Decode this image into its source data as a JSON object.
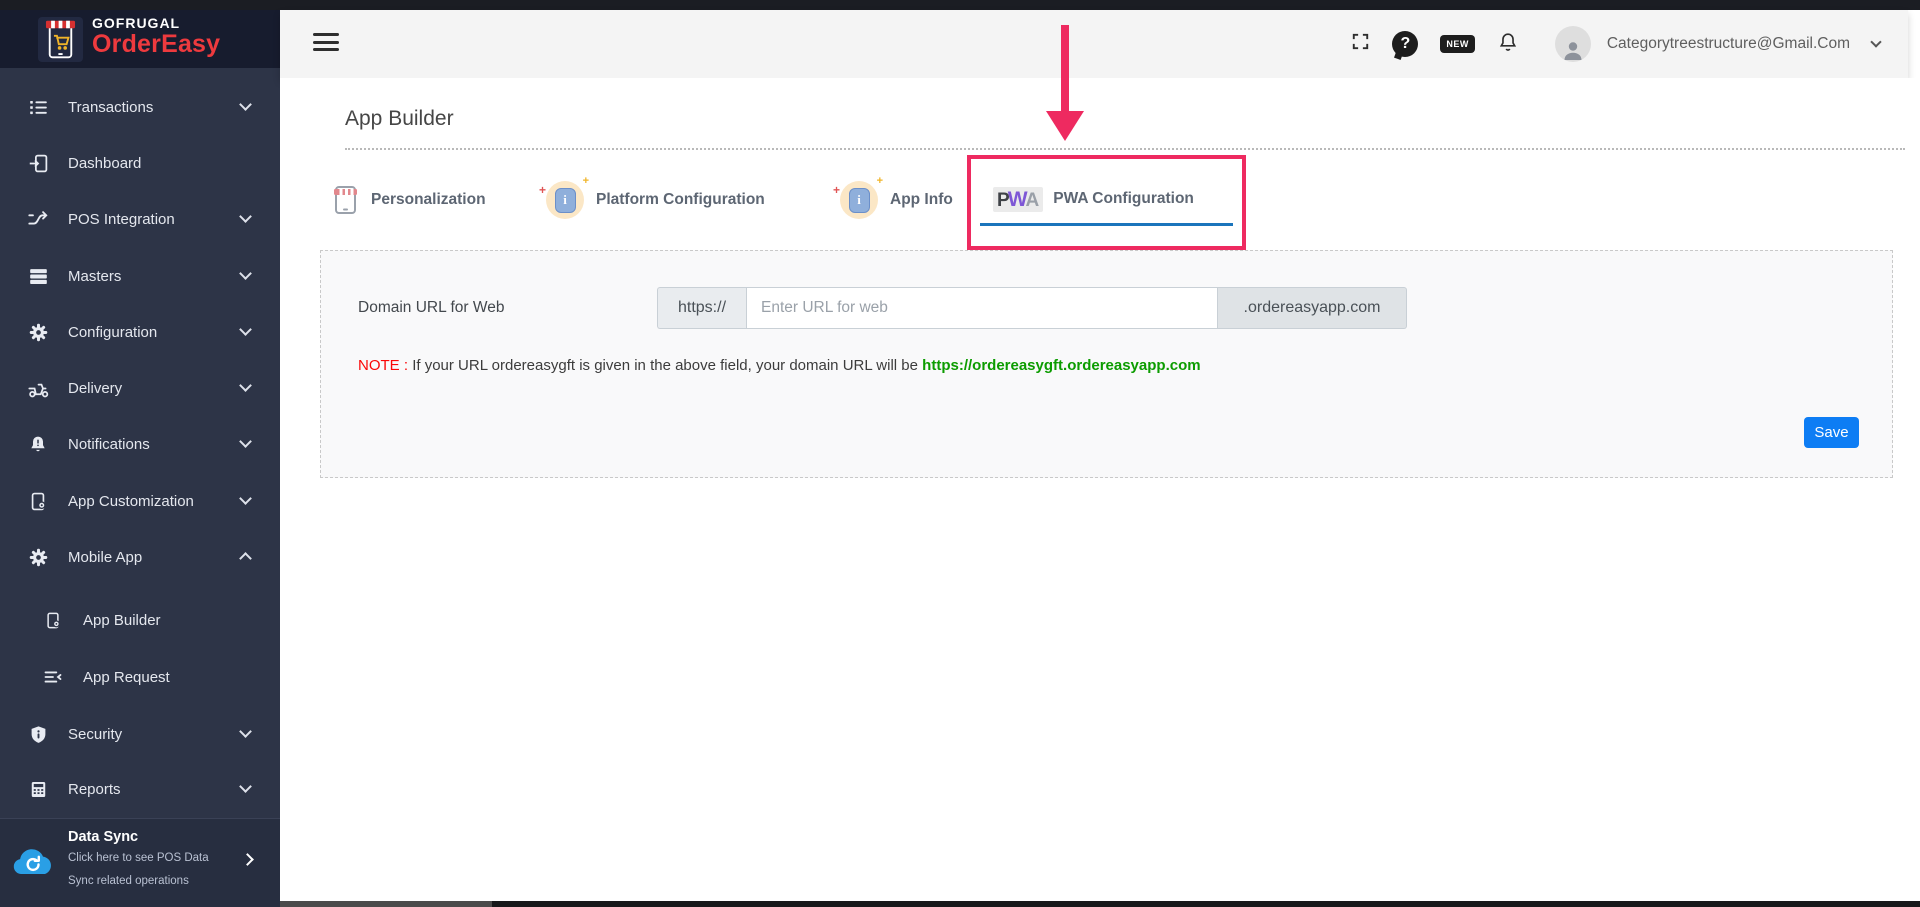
{
  "brand": {
    "company": "GOFRUGAL",
    "product": "OrderEasy"
  },
  "topbar": {
    "user_email": "Categorytreestructure@Gmail.Com",
    "new_badge": "NEW",
    "help_glyph": "?"
  },
  "sidebar": {
    "items": [
      {
        "label": "Transactions",
        "icon": "transactions-list-icon",
        "chevron": "down"
      },
      {
        "label": "Dashboard",
        "icon": "dashboard-icon",
        "chevron": ""
      },
      {
        "label": "POS Integration",
        "icon": "pos-integration-icon",
        "chevron": "down"
      },
      {
        "label": "Masters",
        "icon": "masters-stack-icon",
        "chevron": "down"
      },
      {
        "label": "Configuration",
        "icon": "gear-icon",
        "chevron": "down"
      },
      {
        "label": "Delivery",
        "icon": "delivery-scooter-icon",
        "chevron": "down"
      },
      {
        "label": "Notifications",
        "icon": "bell-icon",
        "chevron": "down"
      },
      {
        "label": "App Customization",
        "icon": "phone-gear-icon",
        "chevron": "down"
      },
      {
        "label": "Mobile App",
        "icon": "gear-icon",
        "chevron": "up"
      },
      {
        "label": "App Builder",
        "icon": "phone-gear-icon",
        "chevron": "",
        "sub": true
      },
      {
        "label": "App Request",
        "icon": "list-chevron-icon",
        "chevron": "",
        "sub": true
      },
      {
        "label": "Security",
        "icon": "shield-icon",
        "chevron": "down"
      },
      {
        "label": "Reports",
        "icon": "reports-icon",
        "chevron": "down"
      }
    ],
    "datasync": {
      "title": "Data Sync",
      "line1": "Click here to see POS Data",
      "line2": "Sync related operations"
    }
  },
  "page": {
    "title": "App Builder"
  },
  "tabs": [
    {
      "label": "Personalization"
    },
    {
      "label": "Platform Configuration"
    },
    {
      "label": "App Info"
    },
    {
      "label": "PWA Configuration",
      "active": true
    }
  ],
  "pwa_logo": {
    "p": "P",
    "w": "W",
    "a": "A"
  },
  "form": {
    "domain_label": "Domain URL for Web",
    "url_prefix": "https://",
    "url_placeholder": "Enter URL for web",
    "url_suffix": ".ordereasyapp.com",
    "note_label": "NOTE :",
    "note_text": "If your URL ordereasygft is given in the above field, your domain URL will be",
    "note_link": "https://ordereasygft.ordereasyapp.com",
    "save_label": "Save"
  },
  "colors": {
    "sidebar_bg": "#2d3447",
    "brand_red": "#ee3a3e",
    "annotation_pink": "#ee2a60",
    "active_tab_underline": "#1b75bc",
    "save_blue": "#0d7df4",
    "note_red": "#fb0707",
    "note_green": "#0c9c00"
  }
}
